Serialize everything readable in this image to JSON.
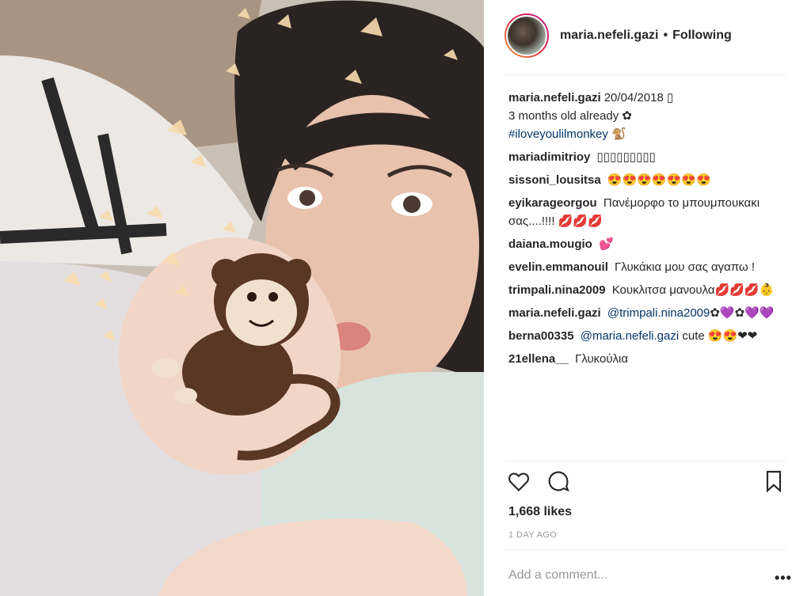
{
  "post": {
    "image_alt": "Selfie of a mother kissing a baby with a monkey sticker and butterfly filter",
    "monkey_sticker_icon": "monkey-sticker-icon",
    "butterfly_icon": "butterfly-icon"
  },
  "header": {
    "username": "maria.nefeli.gazi",
    "dot": "•",
    "follow_state": "Following"
  },
  "comments": [
    {
      "user": "maria.nefeli.gazi",
      "text": "20/04/2018 ▯",
      "line2": "3 months old already ✿",
      "hashtag": "#iloveyoulilmonkey",
      "hashtag_suffix": " 🐒"
    },
    {
      "user": "mariadimitrioy",
      "text": "▯▯▯▯▯▯▯▯▯"
    },
    {
      "user": "sissoni_lousitsa",
      "text": "😍😍😍😍😍😍😍"
    },
    {
      "user": "eyikarageorgou",
      "text": "Πανέμορφο το μπουμπουκακι σας....!!!! 💋💋💋"
    },
    {
      "user": "daiana.mougio",
      "text": "💕"
    },
    {
      "user": "evelin.emmanouil",
      "text": "Γλυκάκια μου σας αγαπω !"
    },
    {
      "user": "trimpali.nina2009",
      "text": "Κουκλιτσα μανουλα💋💋💋👶"
    },
    {
      "user": "maria.nefeli.gazi",
      "mention": "@trimpali.nina2009",
      "text": "✿💜✿💜💜"
    },
    {
      "user": "berna00335",
      "mention": "@maria.nefeli.gazi",
      "text": " cute 😍😍❤❤"
    },
    {
      "user": "21ellena__",
      "text": "Γλυκούλια"
    }
  ],
  "actions": {
    "like_icon": "heart-icon",
    "comment_icon": "comment-icon",
    "save_icon": "bookmark-icon"
  },
  "likes": "1,668 likes",
  "time_ago": "1 DAY AGO",
  "add_comment_placeholder": "Add a comment...",
  "more_label": "•••"
}
